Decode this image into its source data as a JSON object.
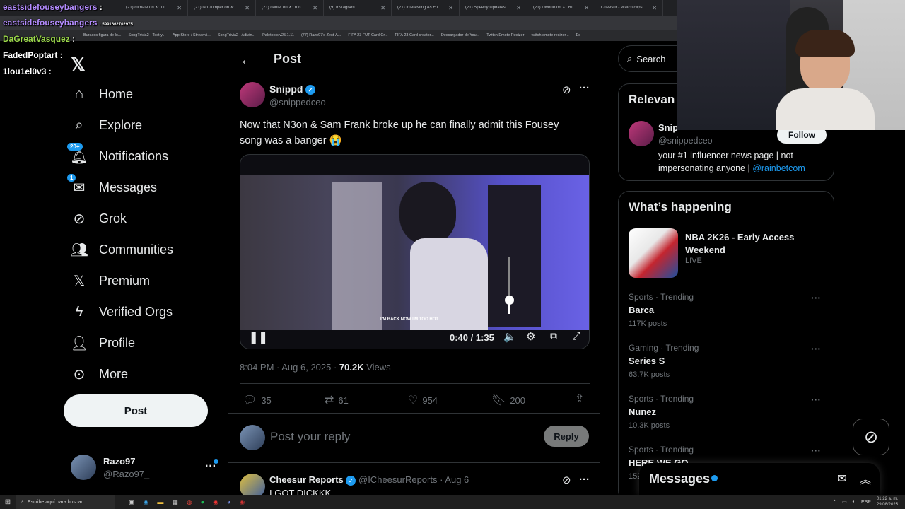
{
  "browser": {
    "tabs": [
      {
        "label": "(21) climate on X: 'Li...'"
      },
      {
        "label": "(21) No Jumper on X: ..."
      },
      {
        "label": "(21) daniel on X: 'ron...'"
      },
      {
        "label": "(9) Instagram"
      },
      {
        "label": "(21) Interesting As Fu..."
      },
      {
        "label": "(21) Speedy Updates ..."
      },
      {
        "label": "(21) Divorto on X: 'Ri...'"
      },
      {
        "label": "Cheesur - Watch clips"
      }
    ],
    "bookmarks": [
      "Buracos figura de lo...",
      "SongTrivia2 - Test y...",
      "App Store / Streamli...",
      "SongTrivia2 - Adivin...",
      "Paletools v25.1.11",
      "(77) Razo97's Zest-A...",
      "FIFA 23 FUT Card Cr...",
      "FIFA 23 Card creator...",
      "Descargador de You...",
      "Twitch Emote Resizer",
      "twitch emote resizer...",
      "Es"
    ]
  },
  "chat_overlay": [
    {
      "user": "eastsidefouseybangers",
      "msg": ":",
      "color": "#b48cff"
    },
    {
      "user": "eastsidefouseybangers",
      "msg": ": 5991662702975",
      "color": "#b48cff"
    },
    {
      "user": "DaGreatVasquez",
      "msg": ":",
      "color": "#9bd84a"
    },
    {
      "user": "FadedPoptart",
      "msg": ":",
      "color": "#ffffff"
    },
    {
      "user": "1lou1el0v3",
      "msg": ":",
      "color": "#ffffff"
    }
  ],
  "nav": {
    "items": [
      {
        "label": "Home",
        "icon": "home-icon"
      },
      {
        "label": "Explore",
        "icon": "search-icon"
      },
      {
        "label": "Notifications",
        "icon": "bell-icon",
        "badge": "20+"
      },
      {
        "label": "Messages",
        "icon": "mail-icon",
        "badge": "1"
      },
      {
        "label": "Grok",
        "icon": "grok-icon"
      },
      {
        "label": "Communities",
        "icon": "communities-icon"
      },
      {
        "label": "Premium",
        "icon": "x-logo-icon"
      },
      {
        "label": "Verified Orgs",
        "icon": "lightning-icon"
      },
      {
        "label": "Profile",
        "icon": "person-icon"
      },
      {
        "label": "More",
        "icon": "more-circle-icon"
      }
    ],
    "post_label": "Post",
    "account": {
      "name": "Razo97",
      "handle": "@Razo97_"
    }
  },
  "post": {
    "header_title": "Post",
    "author_name": "Snippd",
    "author_handle": "@snippedceo",
    "text_line1": "Now that N3on & Sam Frank broke up he can finally admit this Fousey",
    "text_line2": "song was a banger 😭",
    "video": {
      "time": "0:40 / 1:35",
      "caption": "I'M BACK NOW I'M TOO HOT",
      "progress": 0.42,
      "volume": 0.25
    },
    "timestamp": "8:04 PM · Aug 6, 2025 · ",
    "views_count": "70.2K",
    "views_label": " Views",
    "stats": {
      "replies": "35",
      "reposts": "61",
      "likes": "954",
      "bookmarks": "200"
    },
    "reply_placeholder": "Post your reply",
    "reply_button": "Reply"
  },
  "reply": {
    "author_name": "Cheesur Reports",
    "author_handle": "@ICheesurReports · Aug 6",
    "text": "I GOT DICKKK"
  },
  "right": {
    "search_label": "Search",
    "relevant_title": "Relevan",
    "relevant_person": {
      "name": "Snip",
      "handle": "@snippedceo",
      "bio": "your #1 influencer news page | not impersonating anyone | ",
      "bio_link": "@rainbetcom",
      "follow": "Follow"
    },
    "happening_title": "What’s happening",
    "featured": {
      "title_line1": "NBA 2K26 - Early Access",
      "title_line2": "Weekend",
      "status": "LIVE"
    },
    "trends": [
      {
        "category": "Sports · Trending",
        "title": "Barca",
        "count": "117K posts"
      },
      {
        "category": "Gaming · Trending",
        "title": "Series S",
        "count": "63.7K posts"
      },
      {
        "category": "Sports · Trending",
        "title": "Nunez",
        "count": "10.3K posts"
      },
      {
        "category": "Sports · Trending",
        "title": "HERE WE GO",
        "count": "152"
      }
    ],
    "messages_label": "Messages"
  },
  "taskbar": {
    "search_placeholder": "Escribe aquí para buscar",
    "time": "01:22 a. m.",
    "date": "29/08/2025",
    "lang": "ESP"
  }
}
